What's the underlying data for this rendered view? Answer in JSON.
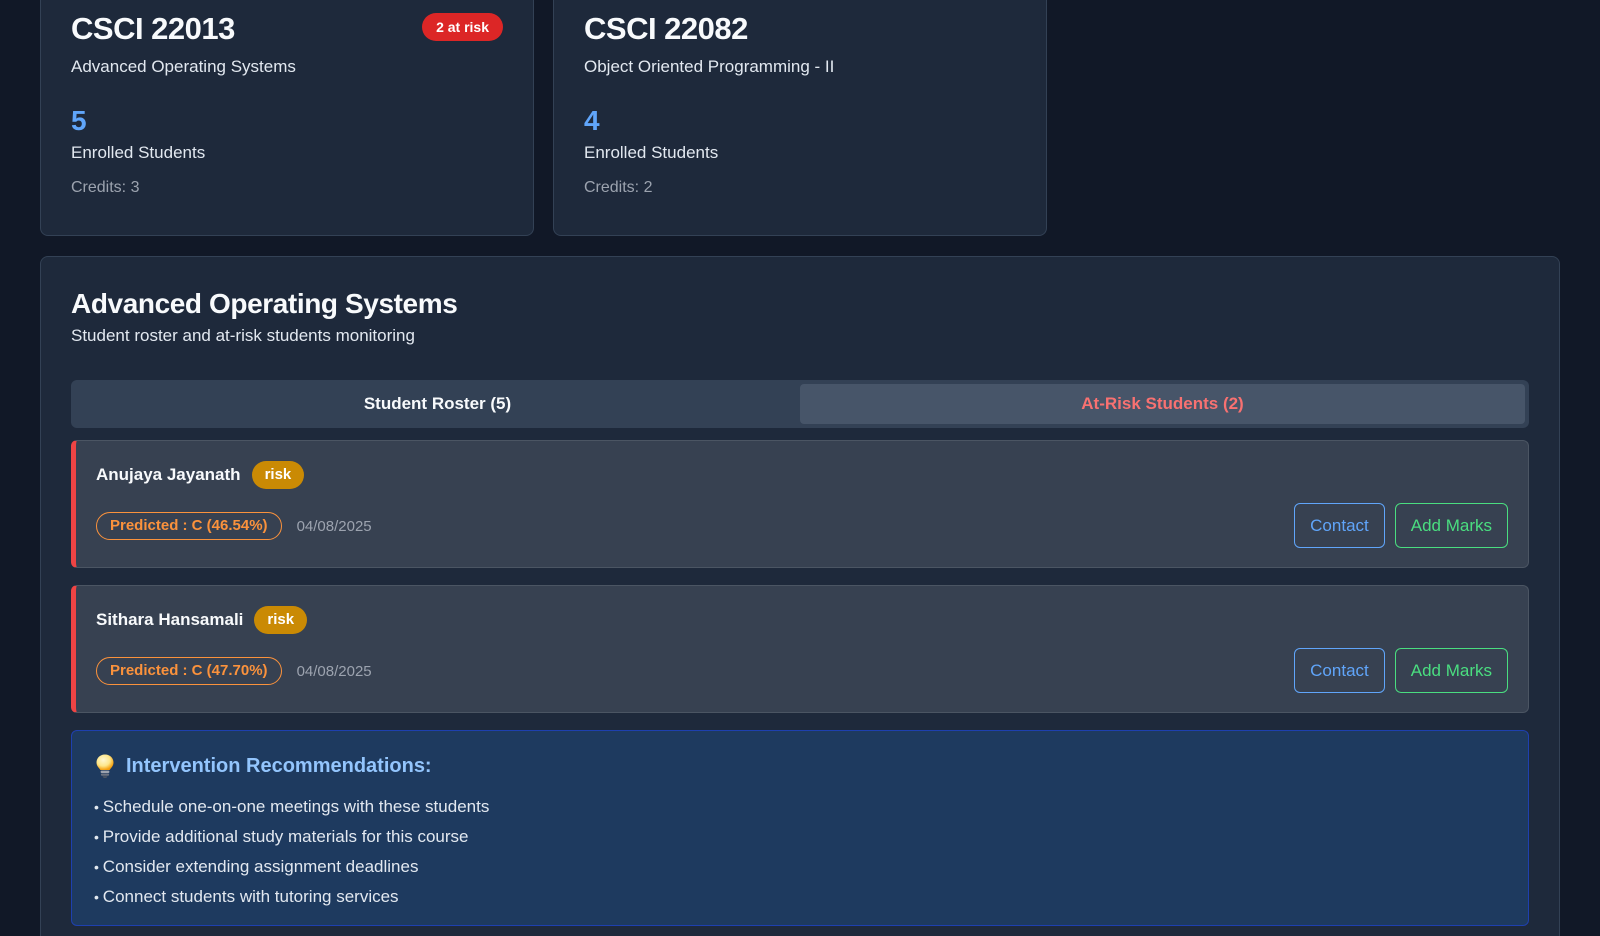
{
  "courses": [
    {
      "code": "CSCI 22013",
      "name": "Advanced Operating Systems",
      "enrolled_count": "5",
      "enrolled_label": "Enrolled Students",
      "credits": "Credits: 3",
      "risk_badge": "2 at risk"
    },
    {
      "code": "CSCI 22082",
      "name": "Object Oriented Programming - II",
      "enrolled_count": "4",
      "enrolled_label": "Enrolled Students",
      "credits": "Credits: 2"
    }
  ],
  "panel": {
    "title": "Advanced Operating Systems",
    "subtitle": "Student roster and at-risk students monitoring",
    "tabs": {
      "roster": "Student Roster (5)",
      "at_risk": "At-Risk Students (2)",
      "active": "at_risk"
    },
    "students": [
      {
        "name": "Anujaya Jayanath",
        "tag": "risk",
        "predicted": "Predicted : C (46.54%)",
        "date": "04/08/2025",
        "contact_label": "Contact",
        "marks_label": "Add Marks"
      },
      {
        "name": "Sithara Hansamali",
        "tag": "risk",
        "predicted": "Predicted : C (47.70%)",
        "date": "04/08/2025",
        "contact_label": "Contact",
        "marks_label": "Add Marks"
      }
    ],
    "recommendations": {
      "icon": "lightbulb-icon",
      "title": "Intervention Recommendations:",
      "items": [
        "Schedule one-on-one meetings with these students",
        "Provide additional study materials for this course",
        "Consider extending assignment deadlines",
        "Connect students with tutoring services"
      ]
    }
  },
  "colors": {
    "background": "#111827",
    "card": "#1e293b",
    "accent_blue": "#60a5fa",
    "danger": "#dc2626",
    "warning": "#ca8a04",
    "predicted": "#fb923c",
    "success": "#4ade80"
  }
}
